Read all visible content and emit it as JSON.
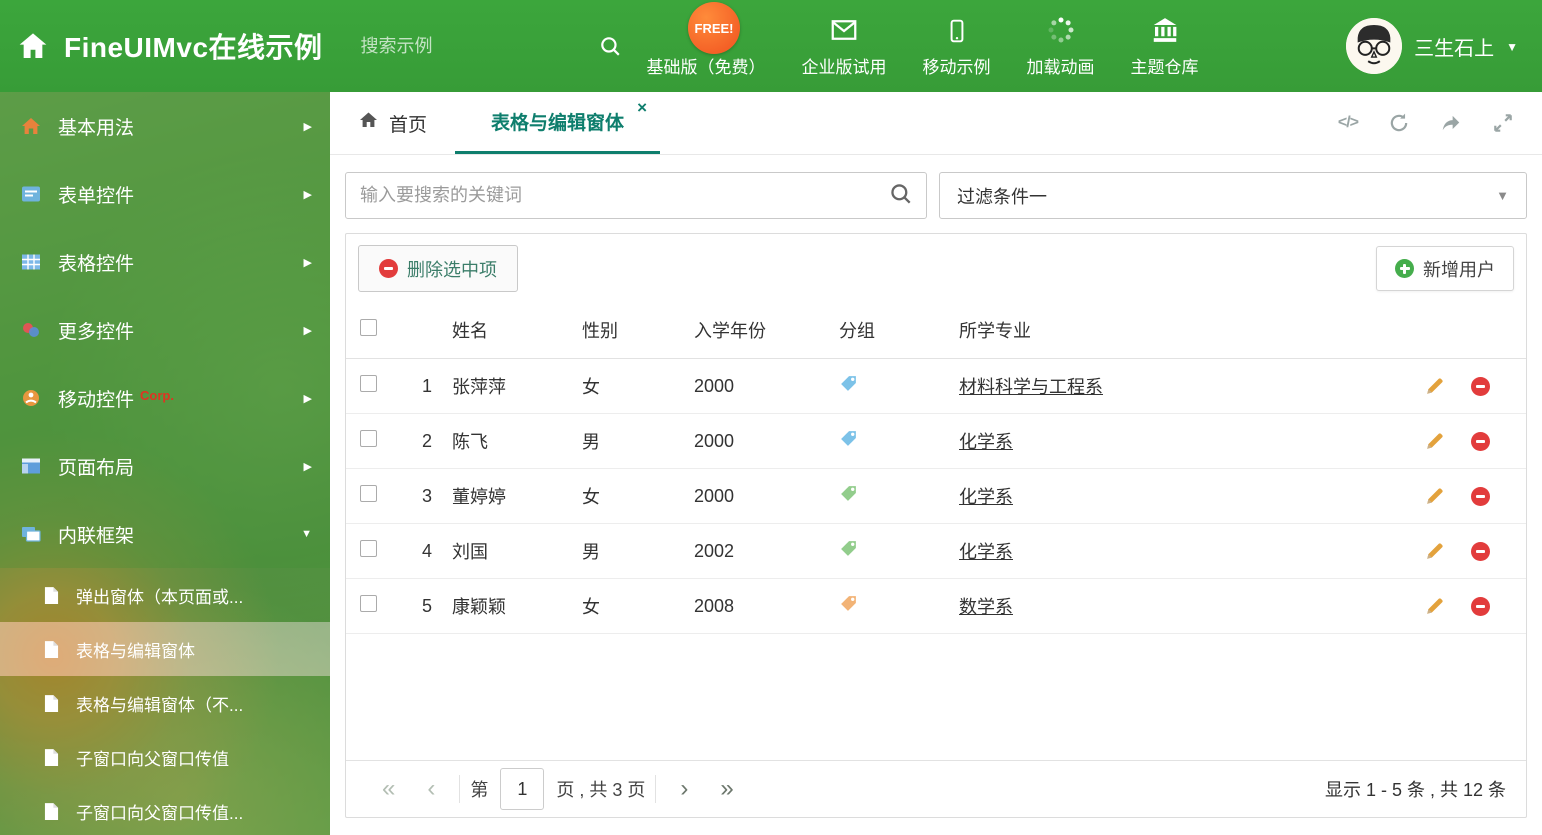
{
  "header": {
    "logo_title": "FineUIMvc在线示例",
    "search_placeholder": "搜索示例",
    "free_badge": "FREE!",
    "nav": [
      {
        "label": "基础版（免费）",
        "icon": "download-icon"
      },
      {
        "label": "企业版试用",
        "icon": "mail-icon"
      },
      {
        "label": "移动示例",
        "icon": "mobile-icon"
      },
      {
        "label": "加载动画",
        "icon": "spinner-icon"
      },
      {
        "label": "主题仓库",
        "icon": "bank-icon"
      }
    ],
    "username": "三生石上"
  },
  "sidebar": {
    "menu": [
      {
        "label": "基本用法",
        "icon": "home-icon",
        "state": "collapsed"
      },
      {
        "label": "表单控件",
        "icon": "form-icon",
        "state": "collapsed"
      },
      {
        "label": "表格控件",
        "icon": "grid-icon",
        "state": "collapsed"
      },
      {
        "label": "更多控件",
        "icon": "widgets-icon",
        "state": "collapsed"
      },
      {
        "label": "移动控件",
        "badge": "Corp.",
        "icon": "mobile-controls-icon",
        "state": "collapsed"
      },
      {
        "label": "页面布局",
        "icon": "layout-icon",
        "state": "collapsed"
      },
      {
        "label": "内联框架",
        "icon": "frame-icon",
        "state": "expanded",
        "children": [
          {
            "label": "弹出窗体（本页面或..."
          },
          {
            "label": "表格与编辑窗体",
            "active": true
          },
          {
            "label": "表格与编辑窗体（不..."
          },
          {
            "label": "子窗口向父窗口传值"
          },
          {
            "label": "子窗口向父窗口传值..."
          }
        ]
      }
    ]
  },
  "tabbar": {
    "home_tab": "首页",
    "active_tab": "表格与编辑窗体",
    "close_label": "×"
  },
  "filters": {
    "search_placeholder": "输入要搜索的关键词",
    "filter_value": "过滤条件一"
  },
  "grid": {
    "toolbar": {
      "delete_button": "删除选中项",
      "add_button": "新增用户"
    },
    "columns": {
      "name": "姓名",
      "gender": "性别",
      "year": "入学年份",
      "group": "分组",
      "major": "所学专业"
    },
    "rows": [
      {
        "index": "1",
        "name": "张萍萍",
        "gender": "女",
        "year": "2000",
        "tag_color": "#7cc2e8",
        "major": "材料科学与工程系"
      },
      {
        "index": "2",
        "name": "陈飞",
        "gender": "男",
        "year": "2000",
        "tag_color": "#7cc2e8",
        "major": "化学系"
      },
      {
        "index": "3",
        "name": "董婷婷",
        "gender": "女",
        "year": "2000",
        "tag_color": "#92cd8c",
        "major": "化学系"
      },
      {
        "index": "4",
        "name": "刘国",
        "gender": "男",
        "year": "2002",
        "tag_color": "#92cd8c",
        "major": "化学系"
      },
      {
        "index": "5",
        "name": "康颖颖",
        "gender": "女",
        "year": "2008",
        "tag_color": "#f2b376",
        "major": "数学系"
      }
    ],
    "pagination": {
      "page_prefix": "第",
      "page_value": "1",
      "page_suffix": "页 , 共 3 页",
      "summary": "显示 1 - 5 条 , 共 12 条"
    }
  },
  "icons": {
    "dropdown_caret": "▼",
    "menu_collapsed": "▶",
    "menu_expanded": "▼",
    "pager_first": "«",
    "pager_prev": "‹",
    "pager_next": "›",
    "pager_last": "»",
    "code_glyph": "</>"
  },
  "colors": {
    "header_green": "#3aa23a",
    "active_tab_teal": "#0e7e6d",
    "delete_red": "#e23c3c",
    "add_green": "#45ad4c",
    "pencil_orange": "#e3a23c",
    "free_badge_orange": "#f0511f"
  }
}
